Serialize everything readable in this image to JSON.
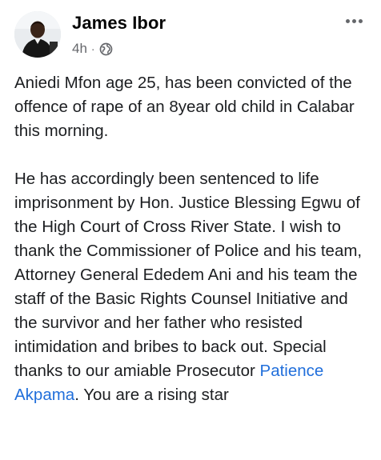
{
  "post": {
    "author": {
      "name": "James Ibor",
      "avatar_icon": "profile-photo"
    },
    "meta": {
      "time": "4h",
      "separator": "·",
      "audience_icon": "globe-icon"
    },
    "menu_icon": "more-options-icon",
    "body": {
      "paragraph_1": "Aniedi Mfon age 25, has been convicted of the offence of rape of an 8year old child in Calabar this morning.",
      "paragraph_2_before_mention": "He has accordingly been sentenced to life imprisonment by Hon. Justice Blessing Egwu of the High Court of Cross River State. I wish to thank the Commissioner of Police and his team, Attorney General Ededem Ani and his team the staff of the Basic Rights Counsel Initiative and the survivor and her father who resisted intimidation and bribes to back out. Special thanks to our amiable Prosecutor ",
      "mention": "Patience Akpama",
      "paragraph_2_after_mention": ". You are a rising star"
    }
  },
  "colors": {
    "text": "#1c1e21",
    "secondary_text": "#65676b",
    "link": "#216fdb",
    "background": "#ffffff"
  }
}
